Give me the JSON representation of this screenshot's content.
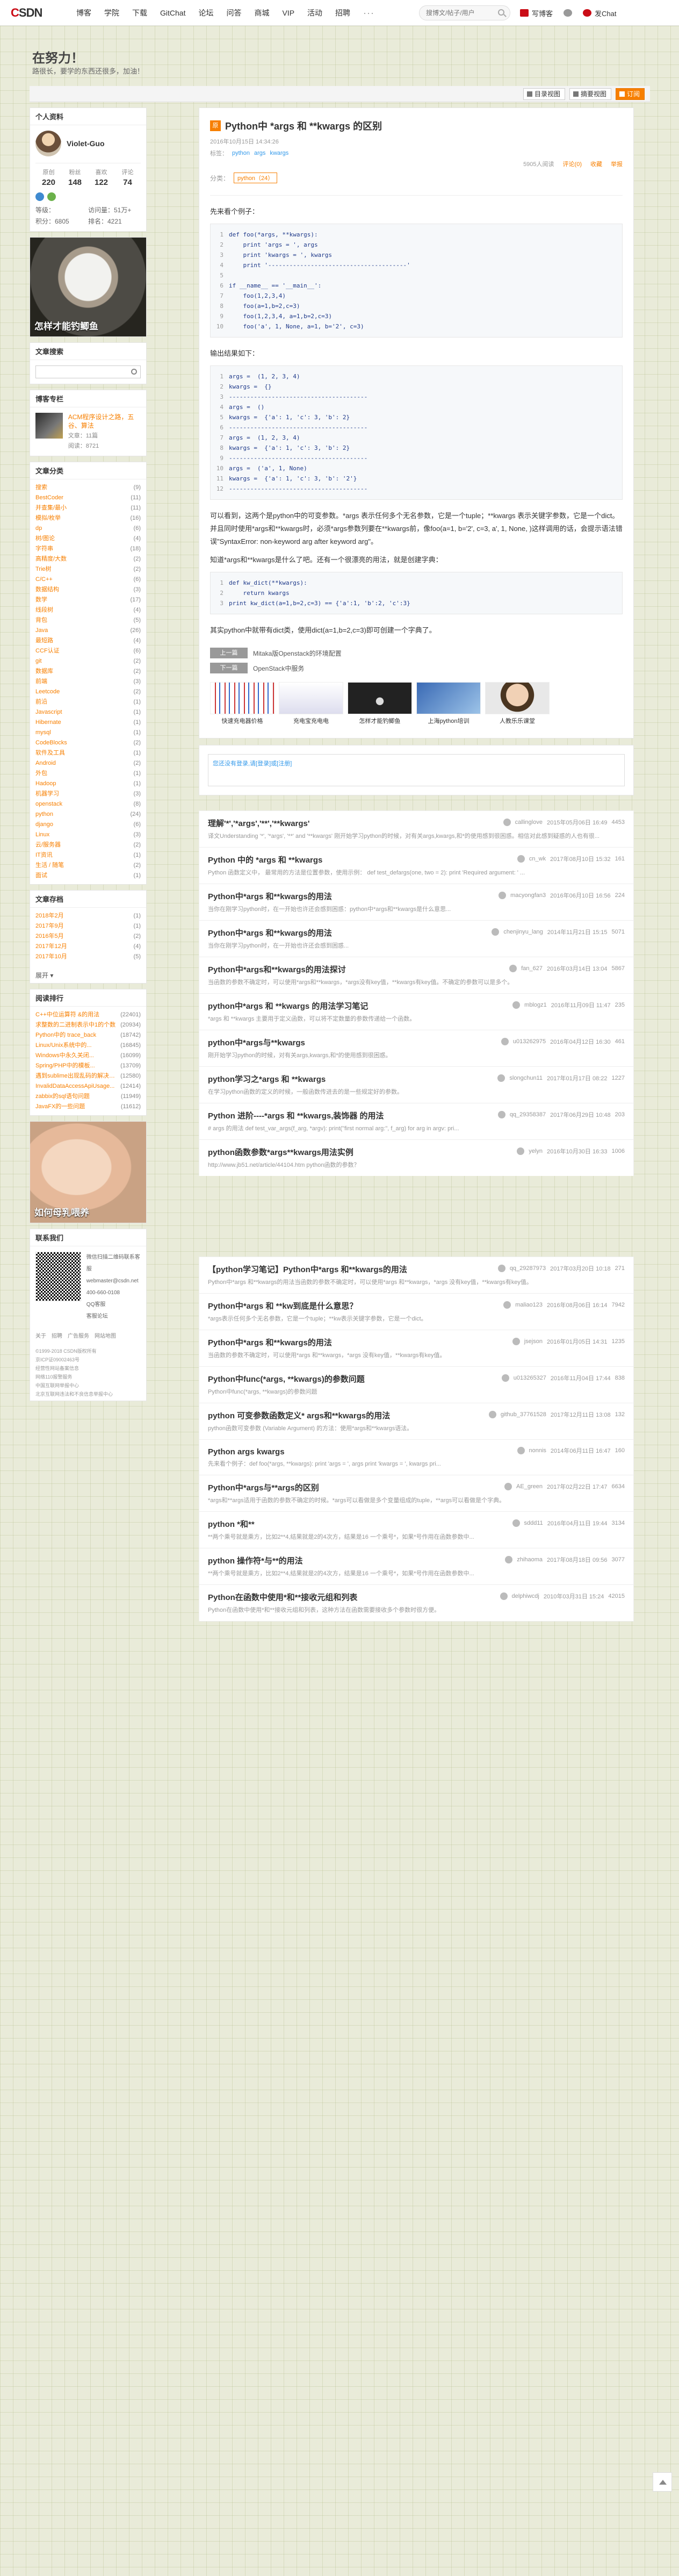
{
  "nav": {
    "logo_c": "C",
    "logo_rest": "SDN",
    "items": [
      "博客",
      "学院",
      "下载",
      "GitChat",
      "论坛",
      "问答",
      "商城",
      "VIP",
      "活动",
      "招聘"
    ],
    "more": "···",
    "search_placeholder": "搜博文/帖子/用户",
    "write_label": "写博客",
    "gitchat_label": "发Chat",
    "notif_label": "消息"
  },
  "header": {
    "blog_title": "在努力！",
    "blog_subtitle": "路很长，要学的东西还很多，加油！",
    "buttons": [
      "目录视图",
      "摘要视图",
      "订阅"
    ]
  },
  "profile": {
    "section_title": "个人资料",
    "username": "Violet-Guo",
    "stats": [
      {
        "k": "原创",
        "v": "220"
      },
      {
        "k": "粉丝",
        "v": "148"
      },
      {
        "k": "喜欢",
        "v": "122"
      },
      {
        "k": "评论",
        "v": "74"
      }
    ],
    "metrics": [
      "等级：",
      "访问量：51万+",
      "积分：6805",
      "排名：4221"
    ]
  },
  "ad1": {
    "caption": "怎样才能钓鲫鱼"
  },
  "search_section": {
    "title": "文章搜索"
  },
  "column_section": {
    "title": "博客专栏",
    "name": "ACM程序设计之路，五谷、算法",
    "count": "文章：11篇",
    "reads": "阅读：8721"
  },
  "categories": {
    "title": "文章分类",
    "items": [
      {
        "name": "搜索",
        "n": "(9)"
      },
      {
        "name": "BestCoder",
        "n": "(11)"
      },
      {
        "name": "并查集/最小",
        "n": "(11)"
      },
      {
        "name": "模拟/枚举",
        "n": "(16)"
      },
      {
        "name": "dp",
        "n": "(6)"
      },
      {
        "name": "树/图论",
        "n": "(4)"
      },
      {
        "name": "字符串",
        "n": "(18)"
      },
      {
        "name": "高精度/大数",
        "n": "(2)"
      },
      {
        "name": "Trie树",
        "n": "(2)"
      },
      {
        "name": "C/C++",
        "n": "(6)"
      },
      {
        "name": "数据结构",
        "n": "(3)"
      },
      {
        "name": "数学",
        "n": "(17)"
      },
      {
        "name": "线段树",
        "n": "(4)"
      },
      {
        "name": "背包",
        "n": "(5)"
      },
      {
        "name": "Java",
        "n": "(26)"
      },
      {
        "name": "最短路",
        "n": "(4)"
      },
      {
        "name": "CCF认证",
        "n": "(6)"
      },
      {
        "name": "git",
        "n": "(2)"
      },
      {
        "name": "数据库",
        "n": "(2)"
      },
      {
        "name": "前端",
        "n": "(3)"
      },
      {
        "name": "Leetcode",
        "n": "(2)"
      },
      {
        "name": "前沿",
        "n": "(1)"
      },
      {
        "name": "Javascript",
        "n": "(1)"
      },
      {
        "name": "Hibernate",
        "n": "(1)"
      },
      {
        "name": "mysql",
        "n": "(1)"
      },
      {
        "name": "CodeBlocks",
        "n": "(2)"
      },
      {
        "name": "软件及工具",
        "n": "(1)"
      },
      {
        "name": "Android",
        "n": "(2)"
      },
      {
        "name": "外包",
        "n": "(1)"
      },
      {
        "name": "Hadoop",
        "n": "(1)"
      },
      {
        "name": "机器学习",
        "n": "(3)"
      },
      {
        "name": "openstack",
        "n": "(8)"
      },
      {
        "name": "python",
        "n": "(24)"
      },
      {
        "name": "django",
        "n": "(6)"
      },
      {
        "name": "Linux",
        "n": "(3)"
      },
      {
        "name": "云/服务器",
        "n": "(2)"
      },
      {
        "name": "IT资讯",
        "n": "(1)"
      },
      {
        "name": "生活 / 随笔",
        "n": "(2)"
      },
      {
        "name": "面试",
        "n": "(1)"
      }
    ]
  },
  "archives": {
    "title": "文章存档",
    "items": [
      {
        "name": "2018年2月",
        "n": "(1)"
      },
      {
        "name": "2017年9月",
        "n": "(1)"
      },
      {
        "name": "2016年5月",
        "n": "(2)"
      },
      {
        "name": "2017年12月",
        "n": "(4)"
      },
      {
        "name": "2017年10月",
        "n": "(5)"
      }
    ],
    "more": "展开 ▾"
  },
  "hot": {
    "title": "阅读排行",
    "items": [
      {
        "name": "C++中位运算符 &#038;的用法",
        "n": "(22401)"
      },
      {
        "name": "求整数的二进制表示中1的个数",
        "n": "(20934)"
      },
      {
        "name": "Python中的 trace_back",
        "n": "(18742)"
      },
      {
        "name": "Linux/Unix系统中的...",
        "n": "(16845)"
      },
      {
        "name": "Windows中永久关闭...",
        "n": "(16099)"
      },
      {
        "name": "Spring/PHP中的模板...",
        "n": "(13709)"
      },
      {
        "name": "遇到sublime出现乱码的解决办法",
        "n": "(12580)"
      },
      {
        "name": "InvalidDataAccessApiUsage...",
        "n": "(12414)"
      },
      {
        "name": "zabbix的sql语句问题",
        "n": "(11949)"
      },
      {
        "name": "JavaFX的一些问题",
        "n": "(11612)"
      }
    ]
  },
  "ad2": {
    "caption": "如何母乳喂养"
  },
  "contact": {
    "title": "联系我们",
    "lines": [
      "微信扫描二维码联系客服",
      "webmaster@csdn.net",
      "400-660-0108",
      "QQ客服",
      "客服论坛"
    ],
    "links": [
      "关于",
      "招聘",
      "广告服务",
      "网站地图"
    ],
    "legal": [
      "©1999-2018 CSDN版权所有",
      "京ICP证09002463号",
      "经营性网站备案信息",
      "网络110报警服务",
      "中国互联网举报中心",
      "北京互联网违法和不良信息举报中心"
    ]
  },
  "article": {
    "orig": "原",
    "title": "Python中 *args 和 **kwargs 的区别",
    "meta": [
      "2016年10月15日 14:34:26"
    ],
    "tags": [
      "标签：",
      "python",
      "args",
      "kwargs"
    ],
    "actions": [
      "5905人阅读",
      "评论(0)",
      "收藏",
      "举报"
    ],
    "label_prefix": "分类：",
    "label": "python（24）",
    "intro": "先来看个例子：",
    "code1": [
      "def foo(*args, **kwargs):",
      "    print 'args = ', args",
      "    print 'kwargs = ', kwargs",
      "    print '---------------------------------------'",
      "",
      "if __name__ == '__main__':",
      "    foo(1,2,3,4)",
      "    foo(a=1,b=2,c=3)",
      "    foo(1,2,3,4, a=1,b=2,c=3)",
      "    foo('a', 1, None, a=1, b='2', c=3)"
    ],
    "out_intro": "输出结果如下：",
    "code2": [
      "args =  (1, 2, 3, 4)",
      "kwargs =  {}",
      "---------------------------------------",
      "args =  ()",
      "kwargs =  {'a': 1, 'c': 3, 'b': 2}",
      "---------------------------------------",
      "args =  (1, 2, 3, 4)",
      "kwargs =  {'a': 1, 'c': 3, 'b': 2}",
      "---------------------------------------",
      "args =  ('a', 1, None)",
      "kwargs =  {'a': 1, 'c': 3, 'b': '2'}",
      "---------------------------------------"
    ],
    "para1": "可以看到，这两个是python中的可变参数。*args 表示任何多个无名参数，它是一个tuple；**kwargs 表示关键字参数，它是一个dict。并且同时使用*args和**kwargs时，必须*args参数列要在**kwargs前，像foo(a=1, b='2', c=3, a', 1, None, )这样调用的话，会提示语法错误\"SyntaxError: non-keyword arg after keyword arg\"。",
    "para2": "知道*args和**kwargs是什么了吧。还有一个很漂亮的用法，就是创建字典：",
    "code3": [
      "def kw_dict(**kwargs):",
      "    return kwargs",
      "print kw_dict(a=1,b=2,c=3) == {'a':1, 'b':2, 'c':3}"
    ],
    "para3": "其实python中就带有dict类，使用dict(a=1,b=2,c=3)即可创建一个字典了。",
    "prev_label": "上一篇",
    "prev_title": "Mitaka版Openstack的环境配置",
    "next_label": "下一篇",
    "next_title": "OpenStack中服务",
    "recs": [
      "快速充电器价格",
      "充电宝充电电",
      "怎样才能钓鲫鱼",
      "上海python培训",
      "人教乐乐课堂"
    ],
    "comment_hint": "您还没有登录,请[登录]或[注册]"
  },
  "related": [
    {
      "title": "理解'*','*args','**','**kwargs'",
      "user": "callinglove",
      "date": "2015年05月06日 16:49",
      "count": "4453",
      "desc": "译文Understanding '*', '*args', '**' and '**kwargs' 刚开始学习python的时候，对有关args,kwargs,和*的使用感到很困惑。相信对此感到疑惑的人也有很..."
    },
    {
      "title": "Python 中的 *args 和 **kwargs",
      "user": "cn_wk",
      "date": "2017年08月10日 15:32",
      "count": "161",
      "desc": "Python 函数定义中， 最常用的方法是位置参数，使用示例： def test_defargs(one, two = 2): print 'Required argument: ' ..."
    },
    {
      "title": "Python中*args 和**kwargs的用法",
      "user": "macyongfan3",
      "date": "2016年06月10日 16:56",
      "count": "224",
      "desc": "当你在刚学习python时，在一开始也许还会感到困惑：python中*args和**kwargs是什么意思..."
    },
    {
      "title": "Python中*args 和**kwargs的用法",
      "user": "chenjinyu_lang",
      "date": "2014年11月21日 15:15",
      "count": "5071",
      "desc": "当你在刚学习python时，在一开始也许还会感到困惑..."
    },
    {
      "title": "Python中*args和**kwargs的用法探讨",
      "user": "fan_627",
      "date": "2016年03月14日 13:04",
      "count": "5867",
      "desc": "当函数的参数不确定时，可以使用*args和**kwargs，*args没有key值，**kwargs有key值。不确定的参数可以是多个。"
    },
    {
      "title": "python中*args 和 **kwargs 的用法学习笔记",
      "user": "mblogz1",
      "date": "2016年11月09日 11:47",
      "count": "235",
      "desc": "*args 和 **kwargs 主要用于定义函数，可以将不定数量的参数传递给一个函数。"
    },
    {
      "title": "python中*args与**kwargs",
      "user": "u013262975",
      "date": "2016年04月12日 16:30",
      "count": "461",
      "desc": "刚开始学习python的时候，对有关args,kwargs,和*的使用感到很困惑。"
    },
    {
      "title": "python学习之*args 和 **kwargs",
      "user": "slongchun11",
      "date": "2017年01月17日 08:22",
      "count": "1227",
      "desc": "在学习python函数的定义的时候，一般函数传进去的是一些规定好的参数。"
    },
    {
      "title": "Python 进阶----*args 和 **kwargs,装饰器 的用法",
      "user": "qq_29358387",
      "date": "2017年06月29日 10:48",
      "count": "203",
      "desc": "# args 的用法 def test_var_args(f_arg, *argv): print(\"first normal arg:\", f_arg) for arg in argv: pri..."
    },
    {
      "title": "python函数参数*args**kwargs用法实例",
      "user": "yelyn",
      "date": "2016年10月30日 16:33",
      "count": "1006",
      "desc": "http://www.jb51.net/article/44104.htm python函数的参数？"
    },
    {
      "title": "【python学习笔记】Python中*args 和**kwargs的用法",
      "user": "qq_29287973",
      "date": "2017年03月20日 10:18",
      "count": "271",
      "desc": "Python中*args 和**kwargs的用法当函数的参数不确定时，可以使用*args 和**kwargs，*args 没有key值，**kwargs有key值。"
    },
    {
      "title": "Python中*args 和 **kw到底是什么意思？",
      "user": "maliao123",
      "date": "2016年08月06日 16:14",
      "count": "7942",
      "desc": "*args表示任何多个无名参数，它是一个tuple；**kw表示关键字参数，它是一个dict。"
    },
    {
      "title": "Python中*args 和**kwargs的用法",
      "user": "jsejson",
      "date": "2016年01月05日 14:31",
      "count": "1235",
      "desc": "当函数的参数不确定时，可以使用*args 和**kwargs，*args 没有key值，**kwargs有key值。"
    },
    {
      "title": "Python中func(*args, **kwargs)的参数问题",
      "user": "u013265327",
      "date": "2016年11月04日 17:44",
      "count": "838",
      "desc": "Python中func(*args, **kwargs)的参数问题"
    },
    {
      "title": "python 可变参数函数定义* args和**kwargs的用法",
      "user": "github_37761528",
      "date": "2017年12月11日 13:08",
      "count": "132",
      "desc": "python函数可变参数 (Variable Argument) 的方法：使用*args和**kwargs语法。"
    },
    {
      "title": "Python args kwargs",
      "user": "nonnis",
      "date": "2014年06月11日 16:47",
      "count": "160",
      "desc": "先来看个例子：def foo(*args, **kwargs): print 'args = ', args print 'kwargs = ', kwargs pri..."
    },
    {
      "title": "Python中*args与**args的区别",
      "user": "AE_green",
      "date": "2017年02月22日 17:47",
      "count": "6634",
      "desc": "*args和**args适用于函数的参数不确定的时候。*args可以看做是多个变量组成的tuple，**args可以看做是个字典。"
    },
    {
      "title": "python *和**",
      "user": "sddd11",
      "date": "2016年04月11日 19:44",
      "count": "3134",
      "desc": "**两个乘号就是乘方，比如2**4,结果就是2的4次方，结果是16 一个乘号*，如果*号作用在函数参数中..."
    },
    {
      "title": "python 操作符*与**的用法",
      "user": "zhihaoma",
      "date": "2017年08月18日 09:56",
      "count": "3077",
      "desc": "**两个乘号就是乘方，比如2**4,结果就是2的4次方，结果是16 一个乘号*，如果*号作用在函数参数中..."
    },
    {
      "title": "Python在函数中使用*和**接收元组和列表",
      "user": "delphiwcdj",
      "date": "2010年03月31日 15:24",
      "count": "42015",
      "desc": "Python在函数中使用*和**接收元组和列表，这种方法在函数需要接收多个参数时很方便。"
    }
  ]
}
